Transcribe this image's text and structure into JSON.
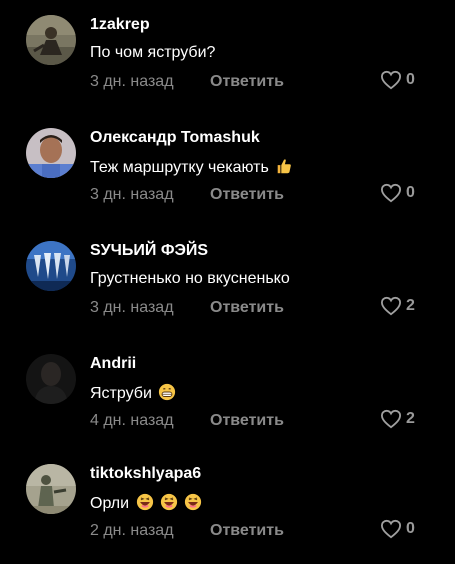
{
  "comments": [
    {
      "username": "1zakrep",
      "text": "По чом яструби?",
      "time": "3 дн. назад",
      "reply_label": "Ответить",
      "likes": "0",
      "emoji": "",
      "avatar_color": "#6d6a55"
    },
    {
      "username": "Олександр Tomashuk",
      "text": "Теж маршрутку чекають",
      "time": "3 дн. назад",
      "reply_label": "Ответить",
      "likes": "0",
      "emoji": "thumbs-up",
      "avatar_color": "#b0a7ad"
    },
    {
      "username": "SУЧЬИЙ ФЭЙS",
      "text": "Грустненько но вкусненько",
      "time": "3 дн. назад",
      "reply_label": "Ответить",
      "likes": "2",
      "emoji": "",
      "avatar_color": "#2a5a9a"
    },
    {
      "username": "Andrii",
      "text": "Яструби",
      "time": "4 дн. назад",
      "reply_label": "Ответить",
      "likes": "2",
      "emoji": "grinning",
      "avatar_color": "#1c1c1c"
    },
    {
      "username": "tiktokshlyapa6",
      "text": "Орли",
      "time": "2 дн. назад",
      "reply_label": "Ответить",
      "likes": "0",
      "emoji": "laughing x3",
      "avatar_color": "#9b9883"
    }
  ],
  "colors": {
    "background": "#000000",
    "username": "#ffffff",
    "meta": "#8a8a8a"
  },
  "icons": {
    "like": "heart-outline-icon"
  }
}
